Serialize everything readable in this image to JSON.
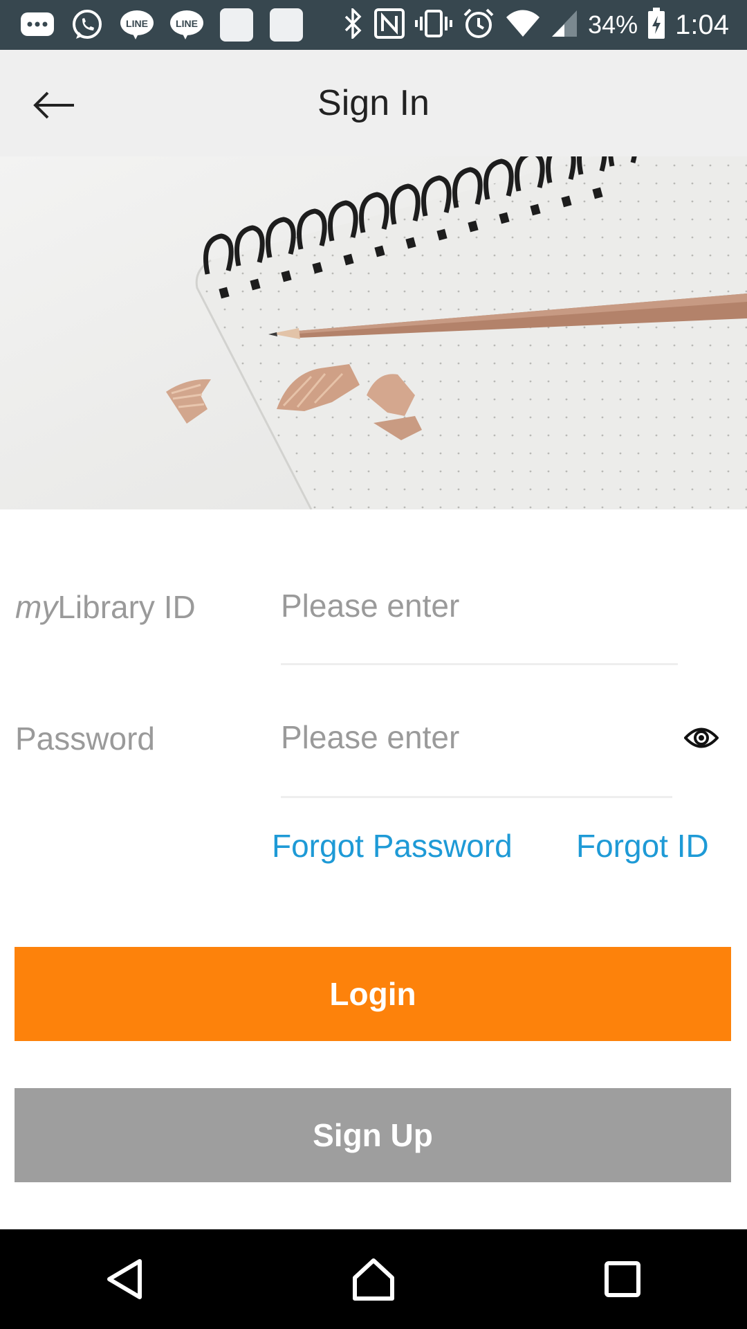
{
  "status_bar": {
    "battery": "34%",
    "time": "1:04",
    "notification_icons": [
      "chat-bubble-icon",
      "whatsapp-icon",
      "line-icon",
      "line-icon",
      "app-icon",
      "app-icon"
    ],
    "system_icons": [
      "bluetooth-icon",
      "nfc-icon",
      "vibrate-icon",
      "alarm-icon",
      "wifi-icon",
      "signal-icon",
      "battery-charging-icon"
    ],
    "line_label": "LINE"
  },
  "header": {
    "title": "Sign In",
    "back_icon": "arrow-left-icon"
  },
  "form": {
    "id_label_prefix": "my",
    "id_label_suffix": "Library ID",
    "id_placeholder": "Please enter",
    "password_label": "Password",
    "password_placeholder": "Please enter",
    "eye_icon": "eye-icon"
  },
  "links": {
    "forgot_password": "Forgot Password",
    "forgot_id": "Forgot ID"
  },
  "buttons": {
    "login": "Login",
    "signup": "Sign Up"
  },
  "colors": {
    "status_bar": "#37474f",
    "app_bar": "#efefef",
    "accent_orange": "#fd820b",
    "signup_gray": "#9e9e9e",
    "link_blue": "#1e9ad6"
  },
  "nav_bar": {
    "icons": [
      "back-triangle-icon",
      "home-icon",
      "recents-icon"
    ]
  }
}
